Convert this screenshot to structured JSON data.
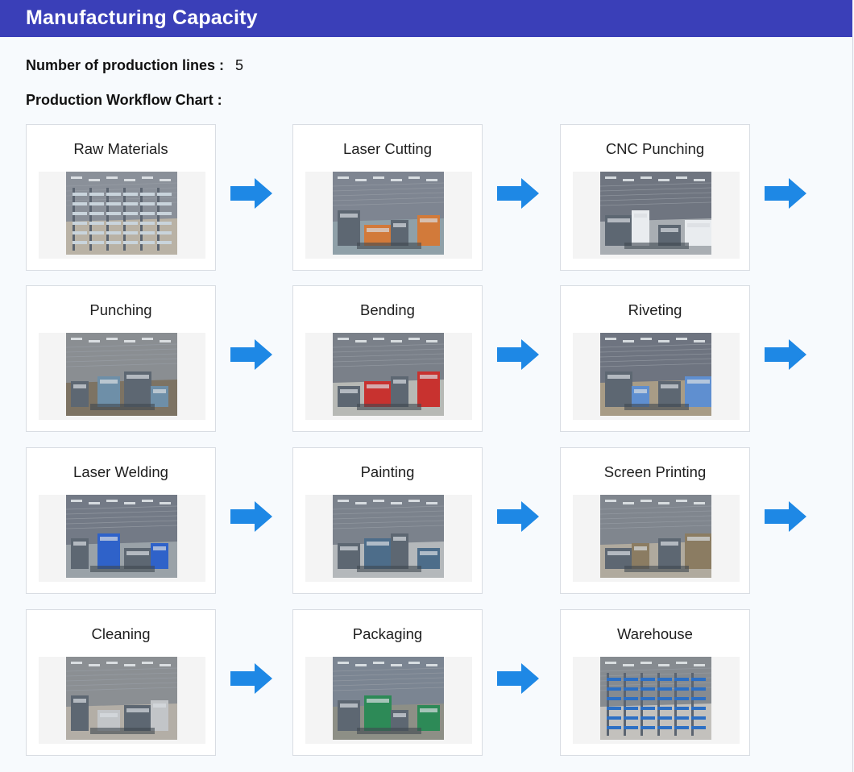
{
  "header": {
    "title": "Manufacturing Capacity"
  },
  "info": {
    "lines_label": "Number of production lines :",
    "lines_value": "5",
    "workflow_label": "Production Workflow Chart :"
  },
  "steps": [
    {
      "label": "Raw Materials",
      "icon": "warehouse-racks-photo"
    },
    {
      "label": "Laser Cutting",
      "icon": "laser-cutter-photo"
    },
    {
      "label": "CNC Punching",
      "icon": "cnc-punch-photo"
    },
    {
      "label": "Punching",
      "icon": "punch-press-photo"
    },
    {
      "label": "Bending",
      "icon": "press-brake-photo"
    },
    {
      "label": "Riveting",
      "icon": "riveting-station-photo"
    },
    {
      "label": "Laser Welding",
      "icon": "welding-robot-photo"
    },
    {
      "label": "Painting",
      "icon": "paint-line-photo"
    },
    {
      "label": "Screen Printing",
      "icon": "screen-print-oven-photo"
    },
    {
      "label": "Cleaning",
      "icon": "cleaning-booth-photo"
    },
    {
      "label": "Packaging",
      "icon": "packaging-line-photo"
    },
    {
      "label": "Warehouse",
      "icon": "finished-goods-racks-photo"
    }
  ],
  "colors": {
    "header": "#3a3fb8",
    "arrow": "#1e88e5",
    "card_border": "#d9dde3"
  }
}
